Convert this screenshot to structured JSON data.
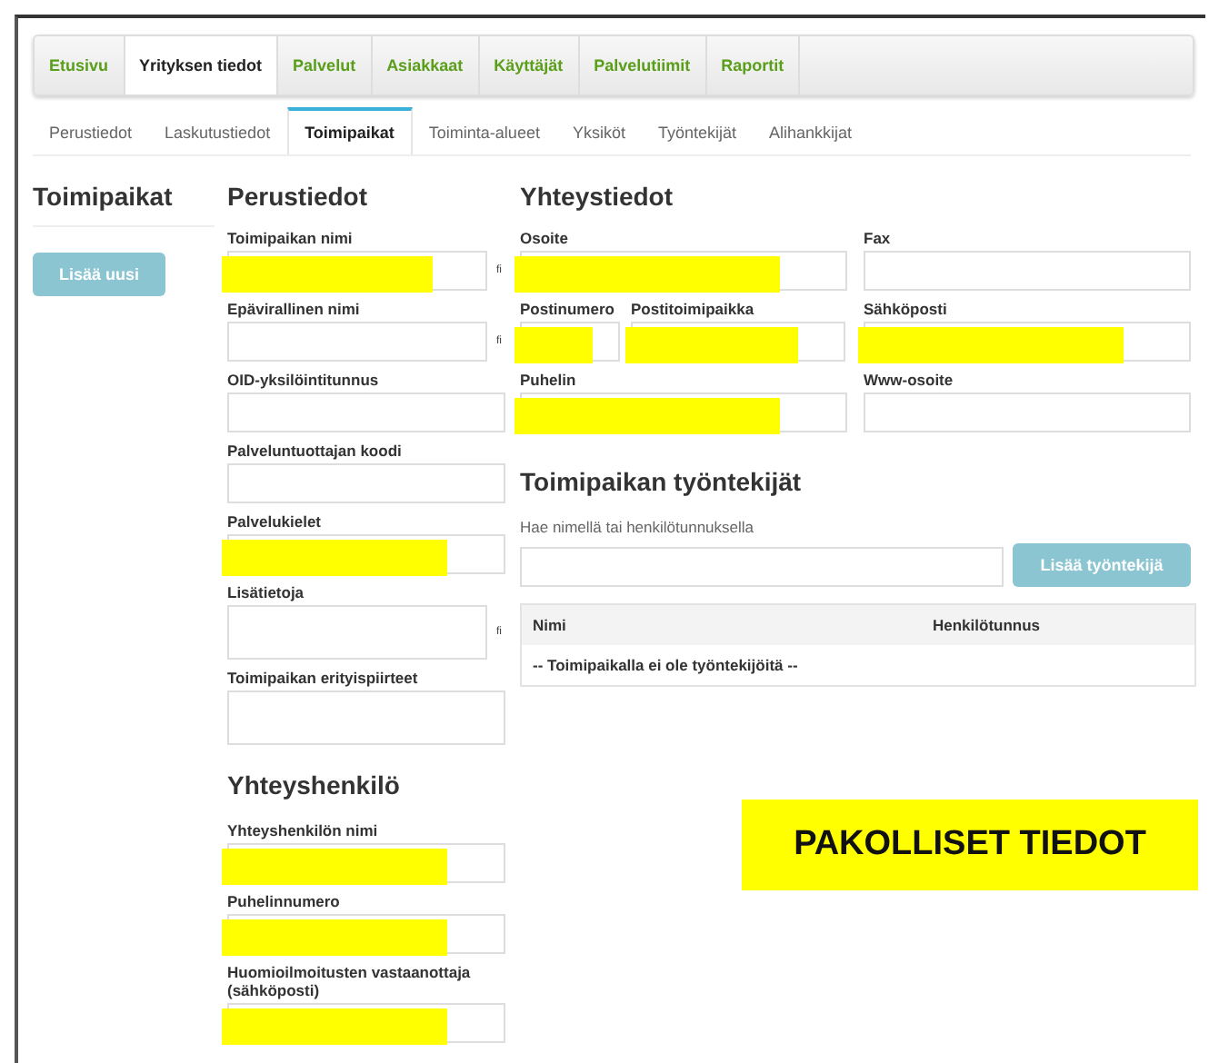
{
  "nav": [
    {
      "label": "Etusivu",
      "selected": false
    },
    {
      "label": "Yrityksen tiedot",
      "selected": true
    },
    {
      "label": "Palvelut",
      "selected": false
    },
    {
      "label": "Asiakkaat",
      "selected": false
    },
    {
      "label": "Käyttäjät",
      "selected": false
    },
    {
      "label": "Palvelutiimit",
      "selected": false
    },
    {
      "label": "Raportit",
      "selected": false
    }
  ],
  "subtabs": [
    {
      "label": "Perustiedot",
      "selected": false
    },
    {
      "label": "Laskutustiedot",
      "selected": false
    },
    {
      "label": "Toimipaikat",
      "selected": true
    },
    {
      "label": "Toiminta-alueet",
      "selected": false
    },
    {
      "label": "Yksiköt",
      "selected": false
    },
    {
      "label": "Työntekijät",
      "selected": false
    },
    {
      "label": "Alihankkijat",
      "selected": false
    }
  ],
  "sidebar": {
    "title": "Toimipaikat",
    "button": "Lisää uusi"
  },
  "basic": {
    "title": "Perustiedot",
    "fields": [
      {
        "label": "Toimipaikan nimi",
        "lang": "fi",
        "required": true,
        "kind": "input"
      },
      {
        "label": "Epävirallinen nimi",
        "lang": "fi",
        "required": false,
        "kind": "input"
      },
      {
        "label": "OID-yksilöintitunnus",
        "required": false,
        "kind": "input"
      },
      {
        "label": "Palveluntuottajan koodi",
        "required": false,
        "kind": "input"
      },
      {
        "label": "Palvelukielet",
        "required": true,
        "kind": "input"
      },
      {
        "label": "Lisätietoja",
        "lang": "fi",
        "required": false,
        "kind": "textarea"
      },
      {
        "label": "Toimipaikan erityispiirteet",
        "required": false,
        "kind": "textarea"
      }
    ]
  },
  "contact": {
    "title": "Yhteystiedot",
    "fields": [
      {
        "label": "Osoite",
        "required": true,
        "kind": "input"
      },
      {
        "label": "Fax",
        "required": false,
        "kind": "input"
      },
      {
        "label": "Postinumero",
        "required": true,
        "kind": "short"
      },
      {
        "label": "Postitoimipaikka",
        "required": true,
        "kind": "medium"
      },
      {
        "label": "Sähköposti",
        "required": true,
        "kind": "input"
      },
      {
        "label": "Puhelin",
        "required": true,
        "kind": "input"
      },
      {
        "label": "Www-osoite",
        "required": false,
        "kind": "input"
      }
    ]
  },
  "employees": {
    "title": "Toimipaikan työntekijät",
    "search_label": "Hae nimellä tai henkilötunnuksella",
    "button": "Lisää työntekijä",
    "columns": [
      "Nimi",
      "Henkilötunnus"
    ],
    "empty": "-- Toimipaikalla ei ole työntekijöitä --"
  },
  "contact_person": {
    "title": "Yhteyshenkilö",
    "fields": [
      {
        "label": "Yhteyshenkilön nimi",
        "required": true,
        "kind": "input"
      },
      {
        "label": "Puhelinnumero",
        "required": true,
        "kind": "input"
      },
      {
        "label": "Huomioilmoitusten vastaanottaja (sähköposti)",
        "required": true,
        "kind": "input"
      }
    ]
  },
  "legend": {
    "text": "PAKOLLISET TIEDOT"
  }
}
